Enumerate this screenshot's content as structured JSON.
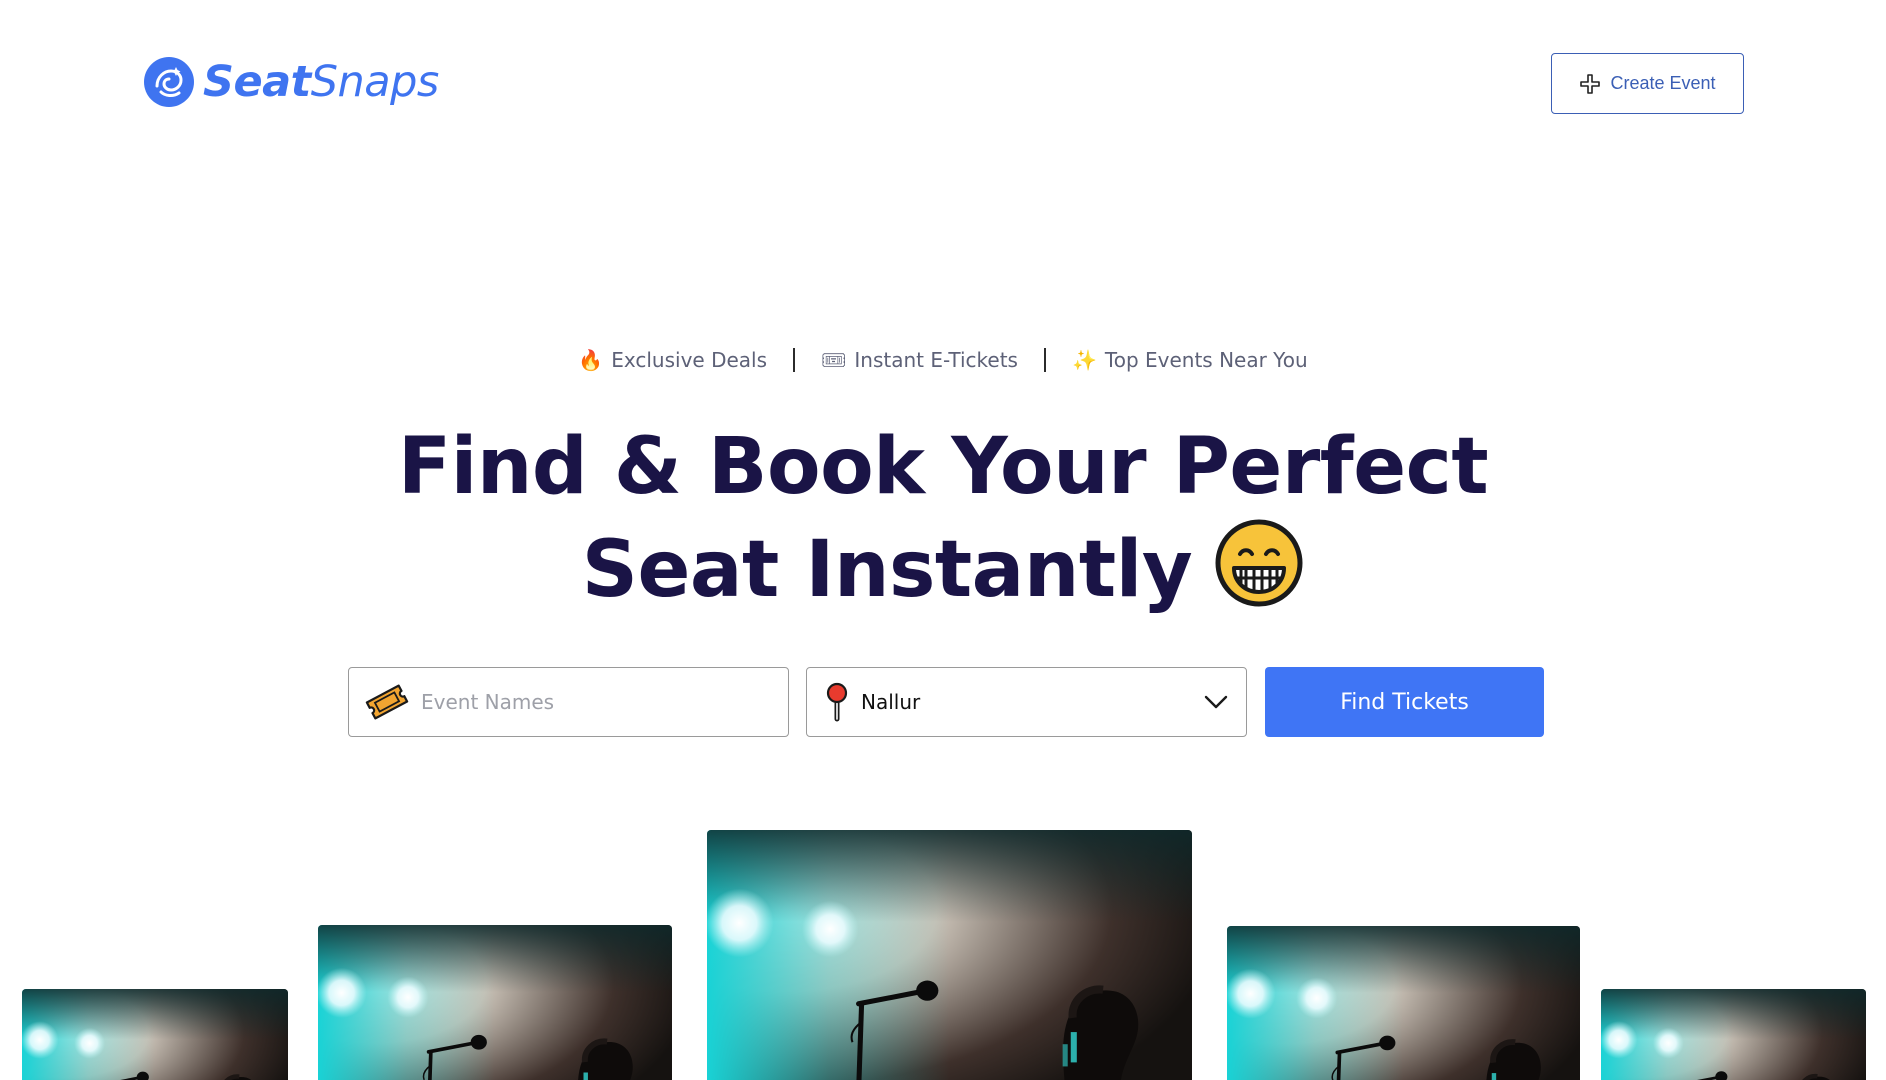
{
  "header": {
    "brand_bold": "Seat",
    "brand_light": "Snaps",
    "create_event_label": "Create Event"
  },
  "tagline": [
    {
      "icon": "fire-icon",
      "emoji": "🔥",
      "label": "Exclusive Deals"
    },
    {
      "icon": "ticket-icon",
      "emoji": "🎟",
      "label": "Instant E-Tickets"
    },
    {
      "icon": "sparkle-icon",
      "emoji": "✨",
      "label": "Top Events Near You"
    }
  ],
  "hero": {
    "line1": "Find & Book Your Perfect",
    "line2": "Seat Instantly"
  },
  "search": {
    "event_placeholder": "Event Names",
    "event_value": "",
    "location_value": "Nallur",
    "submit_label": "Find Tickets"
  },
  "gallery": {
    "items": [
      {
        "subject": "concert-stage-microphone"
      },
      {
        "subject": "concert-stage-microphone"
      },
      {
        "subject": "concert-stage-microphone"
      },
      {
        "subject": "concert-stage-microphone"
      },
      {
        "subject": "concert-stage-microphone"
      }
    ]
  },
  "colors": {
    "brand_blue": "#3f74f0",
    "heading_navy": "#1a1446",
    "button_blue": "#3f75f5",
    "tagline_gray": "#5d6177",
    "stage_cyan": "#19d3d6"
  }
}
